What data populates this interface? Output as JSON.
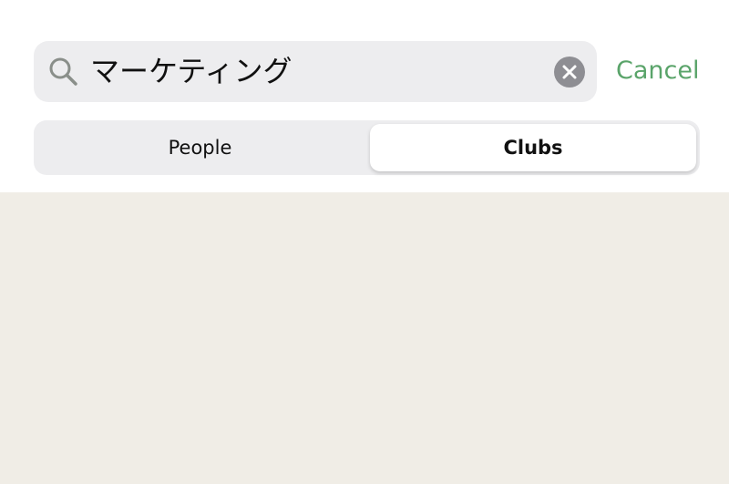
{
  "search": {
    "query": "マーケティング",
    "icon": "search-icon",
    "clear_icon": "clear-icon",
    "cancel_label": "Cancel"
  },
  "tabs": {
    "items": [
      {
        "label": "People",
        "selected": false
      },
      {
        "label": "Clubs",
        "selected": true
      }
    ]
  },
  "colors": {
    "accent": "#5aa46a",
    "search_bg": "#ededef",
    "content_bg": "#f0ede6"
  }
}
